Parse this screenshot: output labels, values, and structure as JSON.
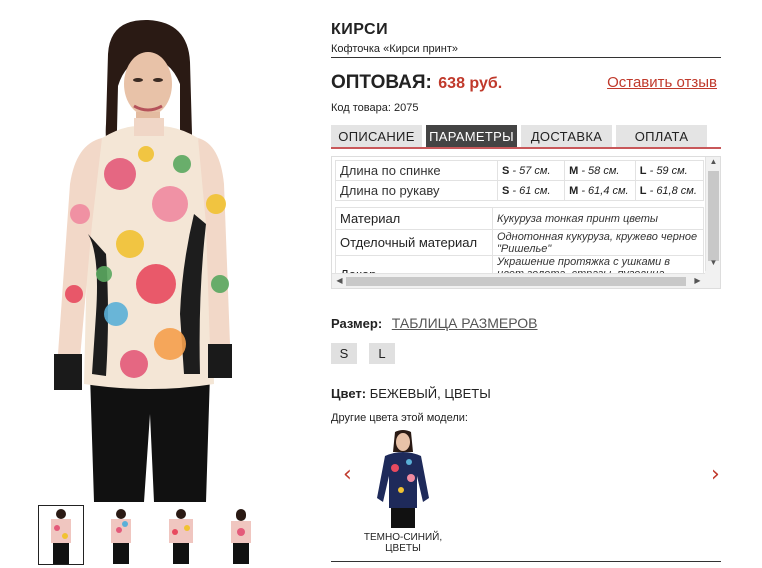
{
  "product": {
    "title": "КИРСИ",
    "subtitle": "Кофточка «Кирси принт»",
    "price_label": "ОПТОВАЯ:",
    "price_value": "638 руб.",
    "review_link": "Оставить отзыв",
    "sku": "Код товара: 2075"
  },
  "tabs": [
    {
      "label": "ОПИСАНИЕ",
      "active": false
    },
    {
      "label": "ПАРАМЕТРЫ",
      "active": true
    },
    {
      "label": "ДОСТАВКА",
      "active": false
    },
    {
      "label": "ОПЛАТА",
      "active": false
    }
  ],
  "params": {
    "measurements": [
      {
        "label": "Длина по спинке",
        "S": "57 см.",
        "M": "58 см.",
        "L": "59 см."
      },
      {
        "label": "Длина по рукаву",
        "S": "61 см.",
        "M": "61,4 см.",
        "L": "61,8 см."
      }
    ],
    "size_keys": {
      "s": "S",
      "m": "M",
      "l": "L",
      "sep": " - "
    },
    "materials": [
      {
        "label": "Материал",
        "value": "Кукуруза тонкая принт цветы"
      },
      {
        "label": "Отделочный материал",
        "value": "Однотонная кукуруза, кружево черное \"Ришелье\""
      },
      {
        "label": "Декор",
        "value": "Украшение протяжка с ушками в цвет золота, стразы, пуговица золотая"
      }
    ]
  },
  "size": {
    "label": "Размер:",
    "table_link": "ТАБЛИЦА РАЗМЕРОВ",
    "options": [
      "S",
      "L"
    ]
  },
  "color": {
    "label": "Цвет:",
    "value": "БЕЖЕВЫЙ, ЦВЕТЫ",
    "other_colors_label": "Другие цвета этой модели:",
    "variants": [
      {
        "label": "ТЕМНО-СИНИЙ, ЦВЕТЫ"
      }
    ]
  },
  "icons": {
    "prev": "chevron-left-icon",
    "next": "chevron-right-icon"
  },
  "colors": {
    "accent": "#c0392b",
    "tab_active": "#444444",
    "tab_inactive": "#e4e4e4",
    "tab_underline": "#c8585a"
  }
}
